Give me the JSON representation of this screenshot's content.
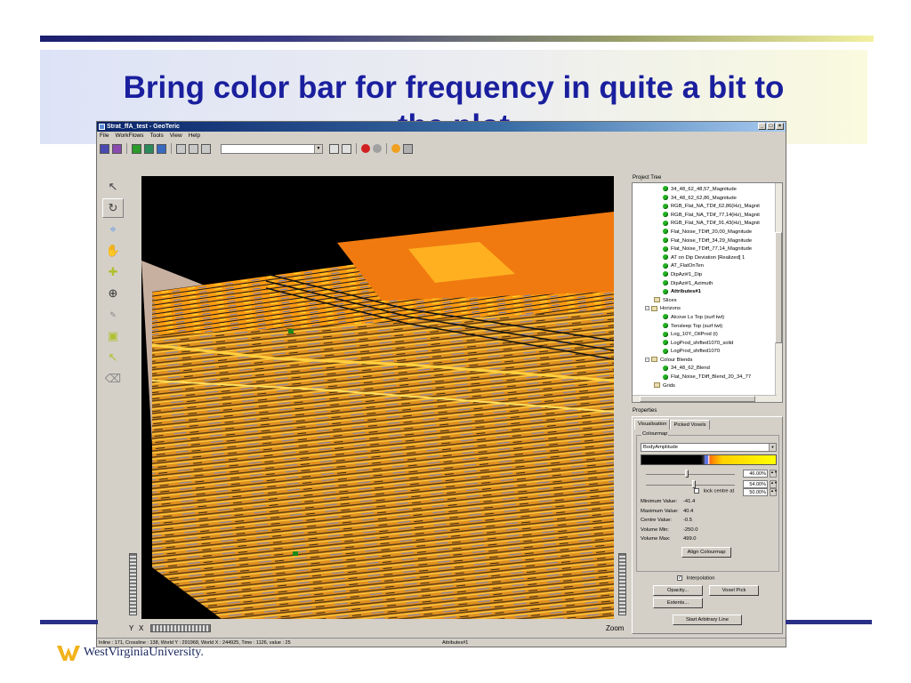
{
  "slide": {
    "title_line1": "Bring color  bar for frequency in quite a bit to",
    "title_line2": "the plot",
    "logo_text": "WestVirginiaUniversity."
  },
  "app": {
    "window_title": "Strat_ffA_test - GeoTeric",
    "menu": [
      "File",
      "WorkFlows",
      "Tools",
      "View",
      "Help"
    ],
    "viewport": {
      "y_axis_label": "Y",
      "x_axis_label": "X",
      "zoom_label": "Zoom"
    },
    "status": {
      "left": "Inline : 171, Crossline : 138, World Y : 291968, World X : 244925, Time : 1126, value : 25",
      "right": "Attributes#1"
    },
    "project_tree": {
      "label": "Project Tree",
      "rows": [
        {
          "kind": "dot",
          "indent": 3,
          "text": "34_48_62_48,57_Magnitude"
        },
        {
          "kind": "dot",
          "indent": 3,
          "text": "34_48_62_62,86_Magnitude"
        },
        {
          "kind": "dot",
          "indent": 3,
          "text": "RGB_Flat_NA_TDif_62,86(Hz)_Magnit"
        },
        {
          "kind": "dot",
          "indent": 3,
          "text": "RGB_Flat_NA_TDif_77,14(Hz)_Magnit"
        },
        {
          "kind": "dot",
          "indent": 3,
          "text": "RGB_Flat_NA_TDif_91,43(Hz)_Magnit"
        },
        {
          "kind": "dot",
          "indent": 3,
          "text": "Flat_Noise_TDiff_20,00_Magnitude"
        },
        {
          "kind": "dot",
          "indent": 3,
          "text": "Flat_Noise_TDiff_34,29_Magnitude"
        },
        {
          "kind": "dot",
          "indent": 3,
          "text": "Flat_Noise_TDiff_77,14_Magnitude"
        },
        {
          "kind": "dot",
          "indent": 3,
          "text": "AT on Dip Deviation [Realized] 1"
        },
        {
          "kind": "dot",
          "indent": 3,
          "text": "AT_FlatOnTen"
        },
        {
          "kind": "dot",
          "indent": 3,
          "text": "DipAzi#1_Dip"
        },
        {
          "kind": "dot",
          "indent": 3,
          "text": "DipAzi#1_Azimuth"
        },
        {
          "kind": "dot",
          "indent": 3,
          "text": "Attributes#1",
          "bold": true
        },
        {
          "kind": "folder",
          "indent": 2,
          "text": "Slices"
        },
        {
          "kind": "folder",
          "indent": 1,
          "text": "Horizons",
          "expander": "−"
        },
        {
          "kind": "dot",
          "indent": 3,
          "text": "Alcove Ls Top (surf twt)"
        },
        {
          "kind": "dot",
          "indent": 3,
          "text": "Tensleep Top (surf twt)"
        },
        {
          "kind": "dot",
          "indent": 3,
          "text": "Log_10Y_OilProd (t)"
        },
        {
          "kind": "dot",
          "indent": 3,
          "text": "LogProd_shifted1070_solid"
        },
        {
          "kind": "dot",
          "indent": 3,
          "text": "LogProd_shifted1070"
        },
        {
          "kind": "folder",
          "indent": 1,
          "text": "Colour Blends",
          "expander": "−"
        },
        {
          "kind": "dot",
          "indent": 3,
          "text": "34_48_62_Blend"
        },
        {
          "kind": "dot",
          "indent": 3,
          "text": "Flat_Noise_TDiff_Blend_20_34_77"
        },
        {
          "kind": "folder",
          "indent": 2,
          "text": "Grids"
        }
      ]
    },
    "properties": {
      "label": "Properties",
      "tabs": [
        "Visualisation",
        "Picked Voxels"
      ],
      "colourmap_group": "Colourmap",
      "colourmap_selected": "BodyAmplitude",
      "slider1_value": "46.00%",
      "slider1_level": 0.46,
      "slider2_value": "54.00%",
      "slider2_level": 0.54,
      "lock_label": "lock centre at",
      "lock_value": "50.00%",
      "values": [
        {
          "k": "Minimum Value:",
          "v": "-41.4"
        },
        {
          "k": "Maximum Value:",
          "v": "40.4"
        },
        {
          "k": "Centre Value:",
          "v": "-0.5"
        },
        {
          "k": "Volume Min:",
          "v": "-250.0"
        },
        {
          "k": "Volume Max:",
          "v": "499.0"
        }
      ],
      "align_button": "Align Colourmap",
      "interpolation_label": "Interpolation",
      "interpolation_checked": true,
      "opacity_button": "Opacity...",
      "voxel_pick_button": "Voxel Pick",
      "extents_button": "Extents...",
      "arbitrary_button": "Start Arbitrary Line"
    },
    "colors": {
      "slide_title": "#1a1f9e",
      "tree_dot": "#22b222",
      "seismic_orange": "#ff8a00",
      "seismic_yellow": "#ffd000"
    }
  }
}
